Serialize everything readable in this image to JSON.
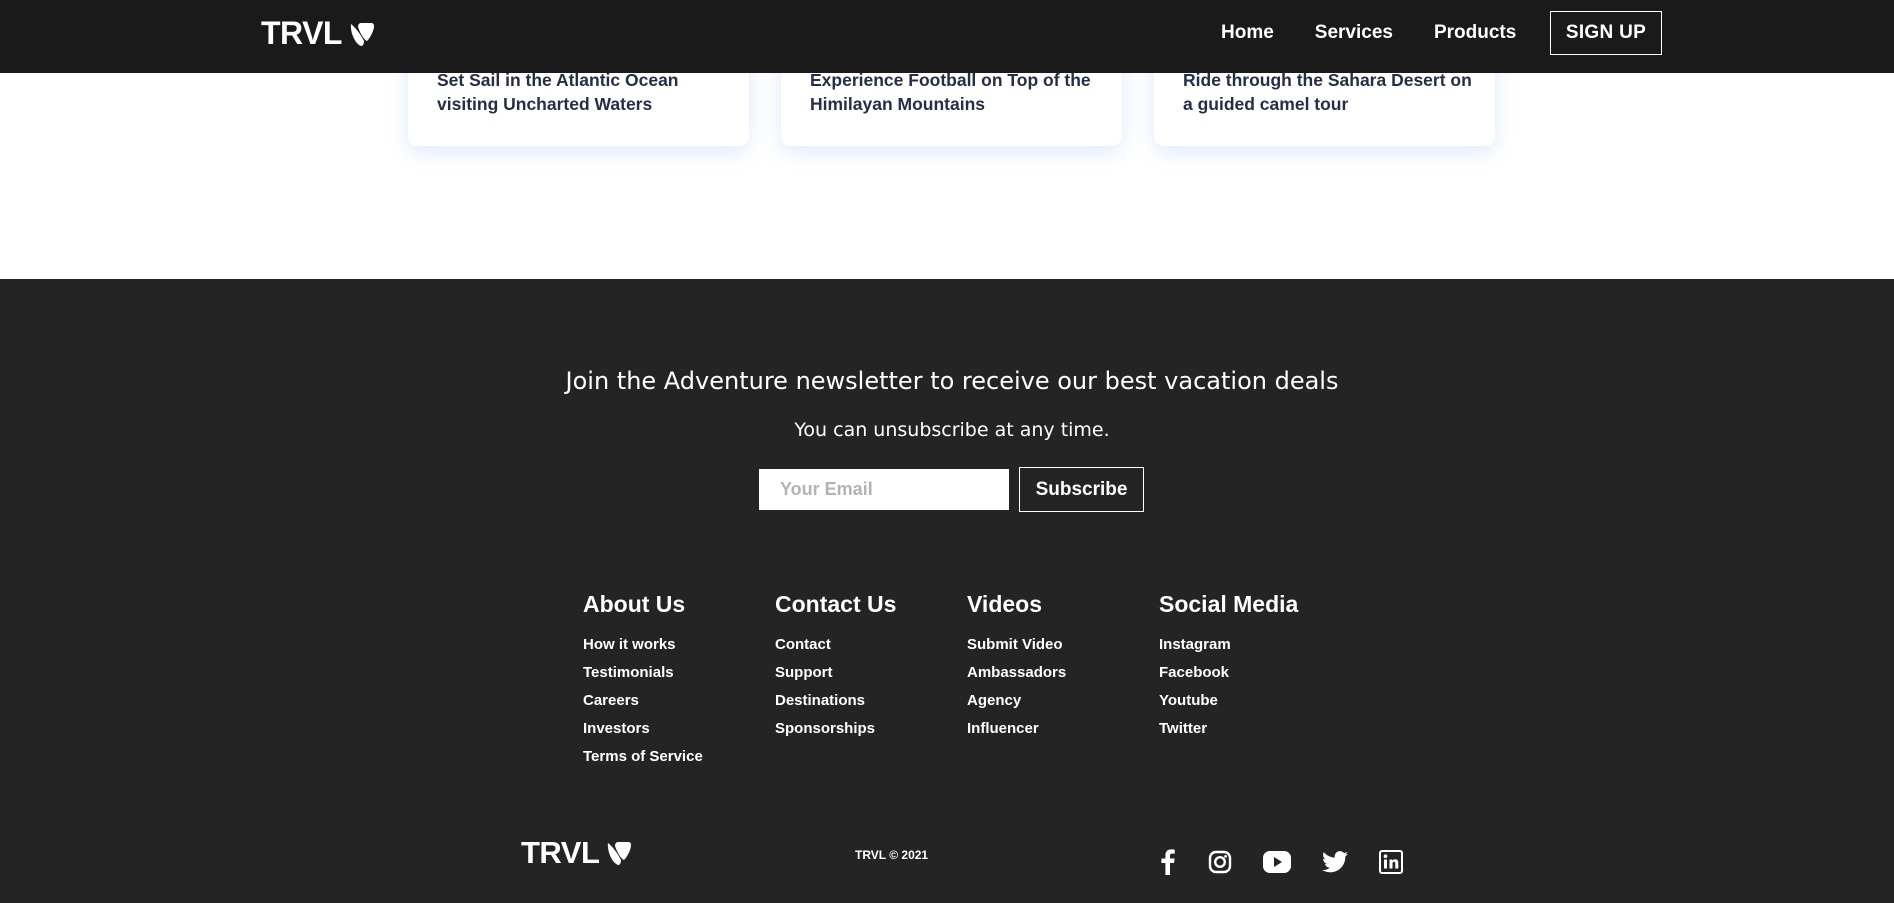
{
  "nav": {
    "logo_text": "TRVL",
    "links": [
      "Home",
      "Services",
      "Products"
    ],
    "signup_label": "SIGN UP"
  },
  "cards": [
    {
      "title": "Set Sail in the Atlantic Ocean visiting Uncharted Waters"
    },
    {
      "title": "Experience Football on Top of the Himilayan Mountains"
    },
    {
      "title": "Ride through the Sahara Desert on a guided camel tour"
    }
  ],
  "newsletter": {
    "heading": "Join the Adventure newsletter to receive our best vacation deals",
    "subtext": "You can unsubscribe at any time.",
    "email_placeholder": "Your Email",
    "email_value": "",
    "subscribe_label": "Subscribe"
  },
  "footer_columns": [
    {
      "title": "About Us",
      "links": [
        "How it works",
        "Testimonials",
        "Careers",
        "Investors",
        "Terms of Service"
      ]
    },
    {
      "title": "Contact Us",
      "links": [
        "Contact",
        "Support",
        "Destinations",
        "Sponsorships"
      ]
    },
    {
      "title": "Videos",
      "links": [
        "Submit Video",
        "Ambassadors",
        "Agency",
        "Influencer"
      ]
    },
    {
      "title": "Social Media",
      "links": [
        "Instagram",
        "Facebook",
        "Youtube",
        "Twitter"
      ]
    }
  ],
  "footer_bottom": {
    "logo_text": "TRVL",
    "copyright": "TRVL © 2021",
    "social_icons": [
      "facebook-icon",
      "instagram-icon",
      "youtube-icon",
      "twitter-icon",
      "linkedin-icon"
    ]
  },
  "colors": {
    "navbar_bg": "#1a1a1a",
    "footer_bg": "#242424",
    "card_text": "#252e48",
    "white": "#ffffff"
  }
}
